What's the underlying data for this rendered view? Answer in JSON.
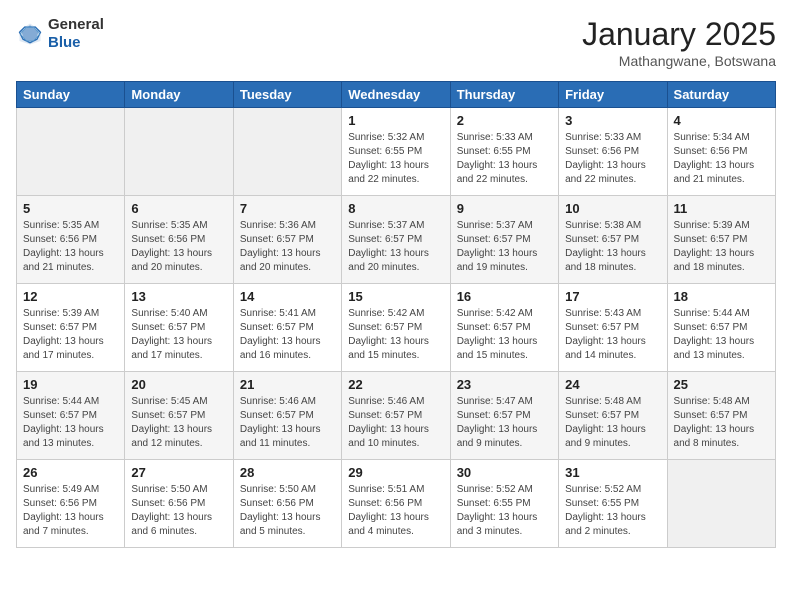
{
  "logo": {
    "line1": "General",
    "line2": "Blue"
  },
  "header": {
    "month": "January 2025",
    "location": "Mathangwane, Botswana"
  },
  "weekdays": [
    "Sunday",
    "Monday",
    "Tuesday",
    "Wednesday",
    "Thursday",
    "Friday",
    "Saturday"
  ],
  "weeks": [
    [
      {
        "day": "",
        "info": ""
      },
      {
        "day": "",
        "info": ""
      },
      {
        "day": "",
        "info": ""
      },
      {
        "day": "1",
        "info": "Sunrise: 5:32 AM\nSunset: 6:55 PM\nDaylight: 13 hours\nand 22 minutes."
      },
      {
        "day": "2",
        "info": "Sunrise: 5:33 AM\nSunset: 6:55 PM\nDaylight: 13 hours\nand 22 minutes."
      },
      {
        "day": "3",
        "info": "Sunrise: 5:33 AM\nSunset: 6:56 PM\nDaylight: 13 hours\nand 22 minutes."
      },
      {
        "day": "4",
        "info": "Sunrise: 5:34 AM\nSunset: 6:56 PM\nDaylight: 13 hours\nand 21 minutes."
      }
    ],
    [
      {
        "day": "5",
        "info": "Sunrise: 5:35 AM\nSunset: 6:56 PM\nDaylight: 13 hours\nand 21 minutes."
      },
      {
        "day": "6",
        "info": "Sunrise: 5:35 AM\nSunset: 6:56 PM\nDaylight: 13 hours\nand 20 minutes."
      },
      {
        "day": "7",
        "info": "Sunrise: 5:36 AM\nSunset: 6:57 PM\nDaylight: 13 hours\nand 20 minutes."
      },
      {
        "day": "8",
        "info": "Sunrise: 5:37 AM\nSunset: 6:57 PM\nDaylight: 13 hours\nand 20 minutes."
      },
      {
        "day": "9",
        "info": "Sunrise: 5:37 AM\nSunset: 6:57 PM\nDaylight: 13 hours\nand 19 minutes."
      },
      {
        "day": "10",
        "info": "Sunrise: 5:38 AM\nSunset: 6:57 PM\nDaylight: 13 hours\nand 18 minutes."
      },
      {
        "day": "11",
        "info": "Sunrise: 5:39 AM\nSunset: 6:57 PM\nDaylight: 13 hours\nand 18 minutes."
      }
    ],
    [
      {
        "day": "12",
        "info": "Sunrise: 5:39 AM\nSunset: 6:57 PM\nDaylight: 13 hours\nand 17 minutes."
      },
      {
        "day": "13",
        "info": "Sunrise: 5:40 AM\nSunset: 6:57 PM\nDaylight: 13 hours\nand 17 minutes."
      },
      {
        "day": "14",
        "info": "Sunrise: 5:41 AM\nSunset: 6:57 PM\nDaylight: 13 hours\nand 16 minutes."
      },
      {
        "day": "15",
        "info": "Sunrise: 5:42 AM\nSunset: 6:57 PM\nDaylight: 13 hours\nand 15 minutes."
      },
      {
        "day": "16",
        "info": "Sunrise: 5:42 AM\nSunset: 6:57 PM\nDaylight: 13 hours\nand 15 minutes."
      },
      {
        "day": "17",
        "info": "Sunrise: 5:43 AM\nSunset: 6:57 PM\nDaylight: 13 hours\nand 14 minutes."
      },
      {
        "day": "18",
        "info": "Sunrise: 5:44 AM\nSunset: 6:57 PM\nDaylight: 13 hours\nand 13 minutes."
      }
    ],
    [
      {
        "day": "19",
        "info": "Sunrise: 5:44 AM\nSunset: 6:57 PM\nDaylight: 13 hours\nand 13 minutes."
      },
      {
        "day": "20",
        "info": "Sunrise: 5:45 AM\nSunset: 6:57 PM\nDaylight: 13 hours\nand 12 minutes."
      },
      {
        "day": "21",
        "info": "Sunrise: 5:46 AM\nSunset: 6:57 PM\nDaylight: 13 hours\nand 11 minutes."
      },
      {
        "day": "22",
        "info": "Sunrise: 5:46 AM\nSunset: 6:57 PM\nDaylight: 13 hours\nand 10 minutes."
      },
      {
        "day": "23",
        "info": "Sunrise: 5:47 AM\nSunset: 6:57 PM\nDaylight: 13 hours\nand 9 minutes."
      },
      {
        "day": "24",
        "info": "Sunrise: 5:48 AM\nSunset: 6:57 PM\nDaylight: 13 hours\nand 9 minutes."
      },
      {
        "day": "25",
        "info": "Sunrise: 5:48 AM\nSunset: 6:57 PM\nDaylight: 13 hours\nand 8 minutes."
      }
    ],
    [
      {
        "day": "26",
        "info": "Sunrise: 5:49 AM\nSunset: 6:56 PM\nDaylight: 13 hours\nand 7 minutes."
      },
      {
        "day": "27",
        "info": "Sunrise: 5:50 AM\nSunset: 6:56 PM\nDaylight: 13 hours\nand 6 minutes."
      },
      {
        "day": "28",
        "info": "Sunrise: 5:50 AM\nSunset: 6:56 PM\nDaylight: 13 hours\nand 5 minutes."
      },
      {
        "day": "29",
        "info": "Sunrise: 5:51 AM\nSunset: 6:56 PM\nDaylight: 13 hours\nand 4 minutes."
      },
      {
        "day": "30",
        "info": "Sunrise: 5:52 AM\nSunset: 6:55 PM\nDaylight: 13 hours\nand 3 minutes."
      },
      {
        "day": "31",
        "info": "Sunrise: 5:52 AM\nSunset: 6:55 PM\nDaylight: 13 hours\nand 2 minutes."
      },
      {
        "day": "",
        "info": ""
      }
    ]
  ]
}
